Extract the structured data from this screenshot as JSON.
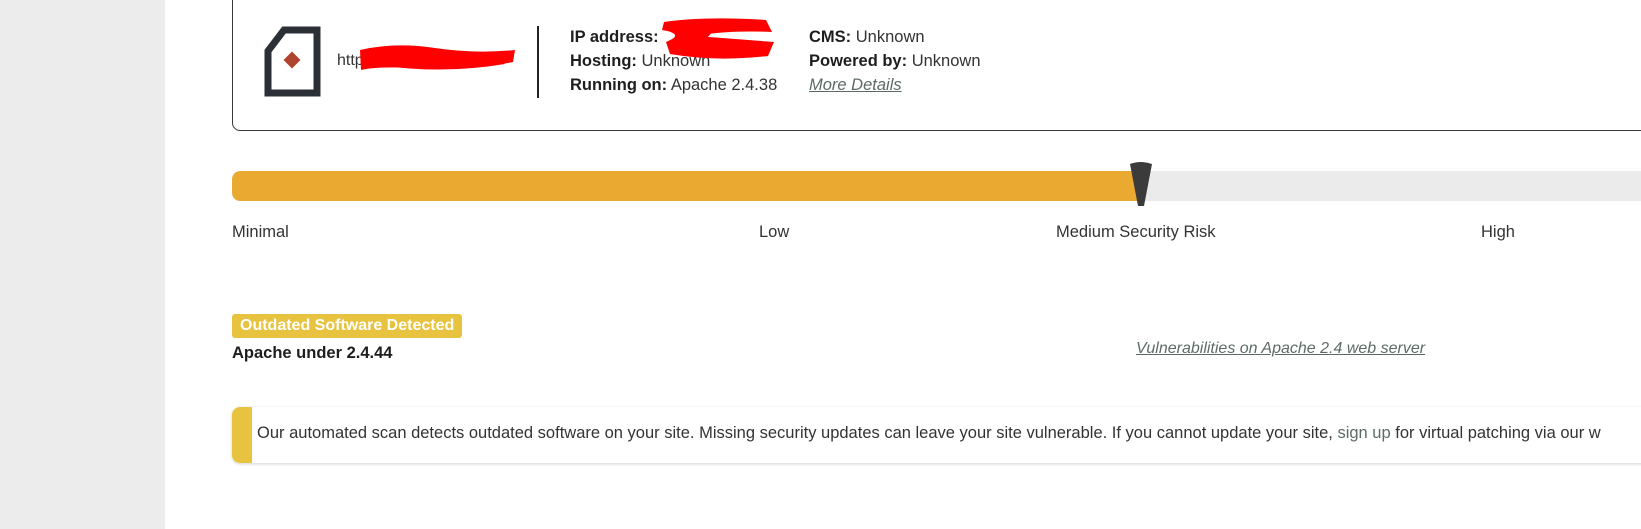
{
  "site": {
    "url_visible_fragment": "http",
    "icon": "site-file-icon",
    "redaction_color": "#ff0000"
  },
  "details": {
    "ip_label": "IP address:",
    "ip_value": "",
    "hosting_label": "Hosting:",
    "hosting_value": "Unknown",
    "running_on_label": "Running on:",
    "running_on_value": "Apache 2.4.38",
    "cms_label": "CMS:",
    "cms_value": "Unknown",
    "powered_by_label": "Powered by:",
    "powered_by_value": "Unknown",
    "more_details": "More Details"
  },
  "risk": {
    "level_fraction": 0.636,
    "fill_color": "#eaaa32",
    "labels": [
      "Minimal",
      "Low",
      "Medium Security Risk",
      "High"
    ],
    "current": "Medium Security Risk"
  },
  "finding": {
    "badge": "Outdated Software Detected",
    "badge_color": "#e7c33f",
    "software": "Apache under 2.4.44",
    "link": "Vulnerabilities on Apache 2.4 web server"
  },
  "notice": {
    "text_before": "Our automated scan detects outdated software on your site. Missing security updates can leave your site vulnerable. If you cannot update your site,",
    "link": "sign up",
    "text_after": "for virtual patching via our w"
  }
}
